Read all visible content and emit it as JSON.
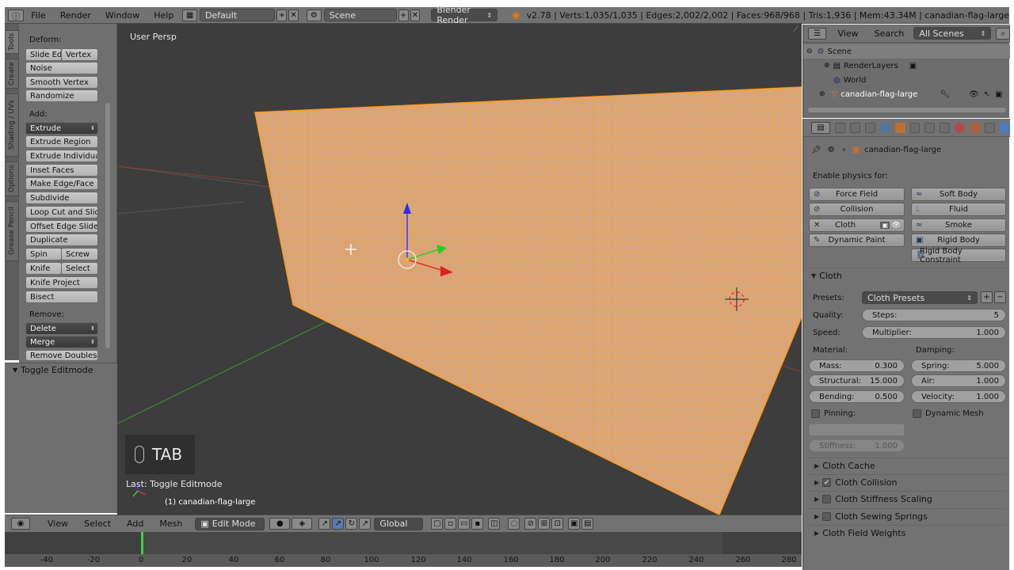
{
  "topbar": {
    "menus": [
      "File",
      "Render",
      "Window",
      "Help"
    ],
    "layout": "Default",
    "scene": "Scene",
    "engine": "Blender Render",
    "stats": "v2.78 | Verts:1,035/1,035 | Edges:2,002/2,002 | Faces:968/968 | Tris:1,936 | Mem:43.34M | canadian-flag-large"
  },
  "sidetabs": [
    "Tools",
    "Create",
    "Shading / UVs",
    "Options",
    "Grease Pencil"
  ],
  "toolshelf": {
    "deform_label": "Deform:",
    "slide_edge": "Slide Ed",
    "vertex": "Vertex",
    "noise": "Noise",
    "smooth_vertex": "Smooth Vertex",
    "randomize": "Randomize",
    "add_label": "Add:",
    "extrude": "Extrude",
    "extrude_region": "Extrude Region",
    "extrude_individual": "Extrude Individual",
    "inset_faces": "Inset Faces",
    "make_edge_face": "Make Edge/Face",
    "subdivide": "Subdivide",
    "loop_cut": "Loop Cut and Slide",
    "offset_edge": "Offset Edge Slide",
    "duplicate": "Duplicate",
    "spin": "Spin",
    "screw": "Screw",
    "knife": "Knife",
    "select": "Select",
    "knife_project": "Knife Project",
    "bisect": "Bisect",
    "remove_label": "Remove:",
    "delete": "Delete",
    "merge": "Merge",
    "remove_doubles": "Remove Doubles",
    "toggle_panel": "Toggle Editmode"
  },
  "viewport": {
    "view_name": "User Persp",
    "key": "TAB",
    "last_op": "Last: Toggle Editmode",
    "object_label": "(1) canadian-flag-large"
  },
  "vp_header": {
    "view": "View",
    "select": "Select",
    "add": "Add",
    "mesh": "Mesh",
    "mode": "Edit Mode",
    "orientation": "Global"
  },
  "timeline": {
    "ticks": [
      "-40",
      "-20",
      "0",
      "20",
      "40",
      "60",
      "80",
      "100",
      "120",
      "140",
      "160",
      "180",
      "200",
      "220",
      "240",
      "260",
      "280"
    ]
  },
  "outliner": {
    "view": "View",
    "search": "Search",
    "filter": "All Scenes",
    "scene": "Scene",
    "render_layers": "RenderLayers",
    "world": "World",
    "object": "canadian-flag-large"
  },
  "properties": {
    "object": "canadian-flag-large",
    "enable_physics": "Enable physics for:",
    "force_field": "Force Field",
    "soft_body": "Soft Body",
    "collision": "Collision",
    "fluid": "Fluid",
    "cloth": "Cloth",
    "smoke": "Smoke",
    "dynamic_paint": "Dynamic Paint",
    "rigid_body": "Rigid Body",
    "rigid_body_constraint": "Rigid Body Constraint",
    "cloth_section": "Cloth",
    "presets_label": "Presets:",
    "presets_value": "Cloth Presets",
    "quality_label": "Quality:",
    "steps_label": "Steps:",
    "steps_value": "5",
    "speed_label": "Speed:",
    "multiplier_label": "Multiplier:",
    "multiplier_value": "1.000",
    "material_label": "Material:",
    "damping_label": "Damping:",
    "mass_label": "Mass:",
    "mass_value": "0.300",
    "spring_label": "Spring:",
    "spring_value": "5.000",
    "structural_label": "Structural:",
    "structural_value": "15.000",
    "air_label": "Air:",
    "air_value": "1.000",
    "bending_label": "Bending:",
    "bending_value": "0.500",
    "velocity_label": "Velocity:",
    "velocity_value": "1.000",
    "pinning_label": "Pinning:",
    "dynamic_mesh_label": "Dynamic Mesh",
    "stiffness_label": "Stiffness:",
    "stiffness_value": "1.000",
    "cloth_cache": "Cloth Cache",
    "cloth_collision": "Cloth Collision",
    "cloth_stiffness_scaling": "Cloth Stiffness Scaling",
    "cloth_sewing_springs": "Cloth Sewing Springs",
    "cloth_field_weights": "Cloth Field Weights"
  },
  "colors": {
    "mesh_face": "#d9a57a",
    "mesh_wire": "#ff9a1a",
    "viewport_bg": "#3d3d3d",
    "panel_bg": "#727272"
  }
}
